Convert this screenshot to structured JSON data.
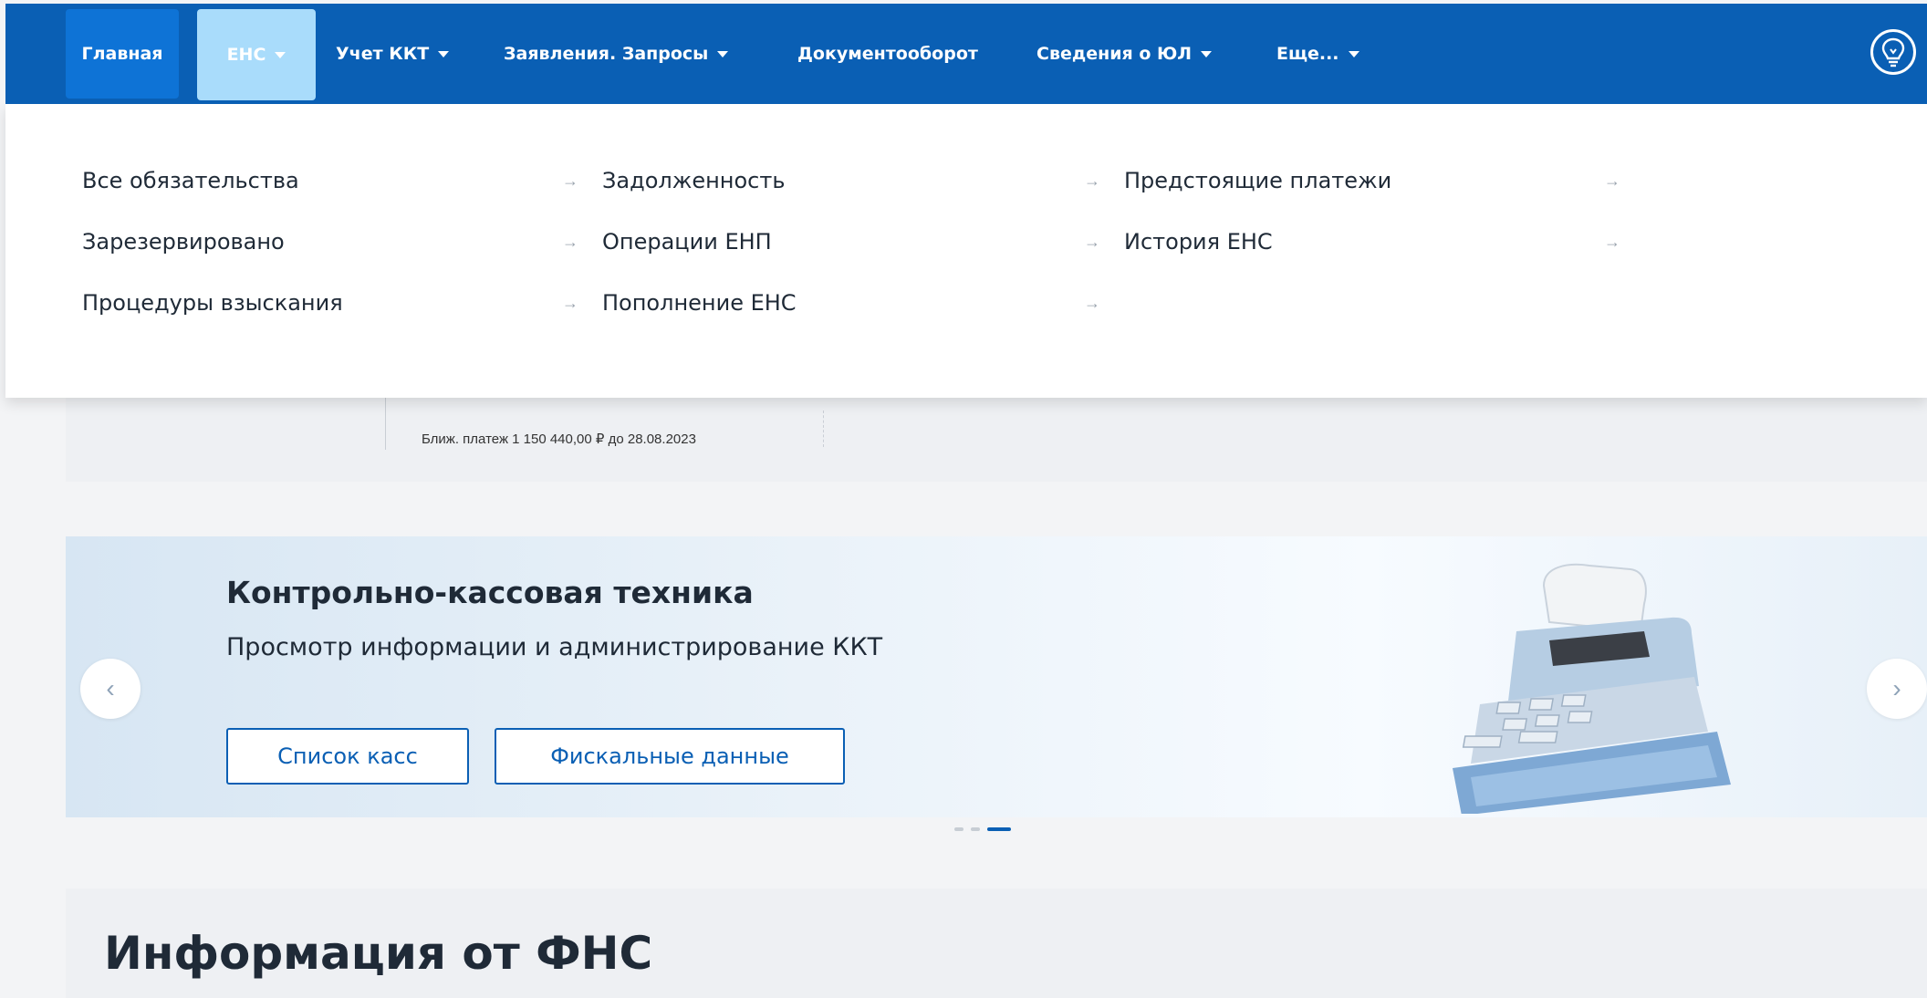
{
  "nav": {
    "home": "Главная",
    "ens": "ЕНС",
    "kkt": "Учет ККТ",
    "applications": "Заявления. Запросы",
    "documents": "Документооборот",
    "company_info": "Сведения о ЮЛ",
    "more": "Еще...",
    "hint_icon": "lightbulb-icon"
  },
  "dropdown": {
    "col1": [
      "Все обязательства",
      "Зарезервировано",
      "Процедуры взыскания"
    ],
    "col2": [
      "Задолженность",
      "Операции ЕНП",
      "Пополнение ЕНС"
    ],
    "col3": [
      "Предстоящие платежи",
      "История ЕНС"
    ],
    "arrow_icon": "arrow-right-icon"
  },
  "balance": {
    "next_payment": "Ближ. платеж 1 150 440,00 ₽ до 28.08.2023"
  },
  "banner": {
    "title": "Контрольно-кассовая техника",
    "subtitle": "Просмотр информации и администрирование ККТ",
    "btn_list": "Список касс",
    "btn_fiscal": "Фискальные данные",
    "prev_icon": "chevron-left-icon",
    "next_icon": "chevron-right-icon",
    "illustration_icon": "cash-register-icon",
    "slides_total": 3,
    "active_slide": 3
  },
  "info": {
    "title": "Информация от ФНС"
  },
  "colors": {
    "nav_bg": "#0a5fb4",
    "nav_active": "#a9dcfb",
    "accent": "#0a5fb4"
  }
}
